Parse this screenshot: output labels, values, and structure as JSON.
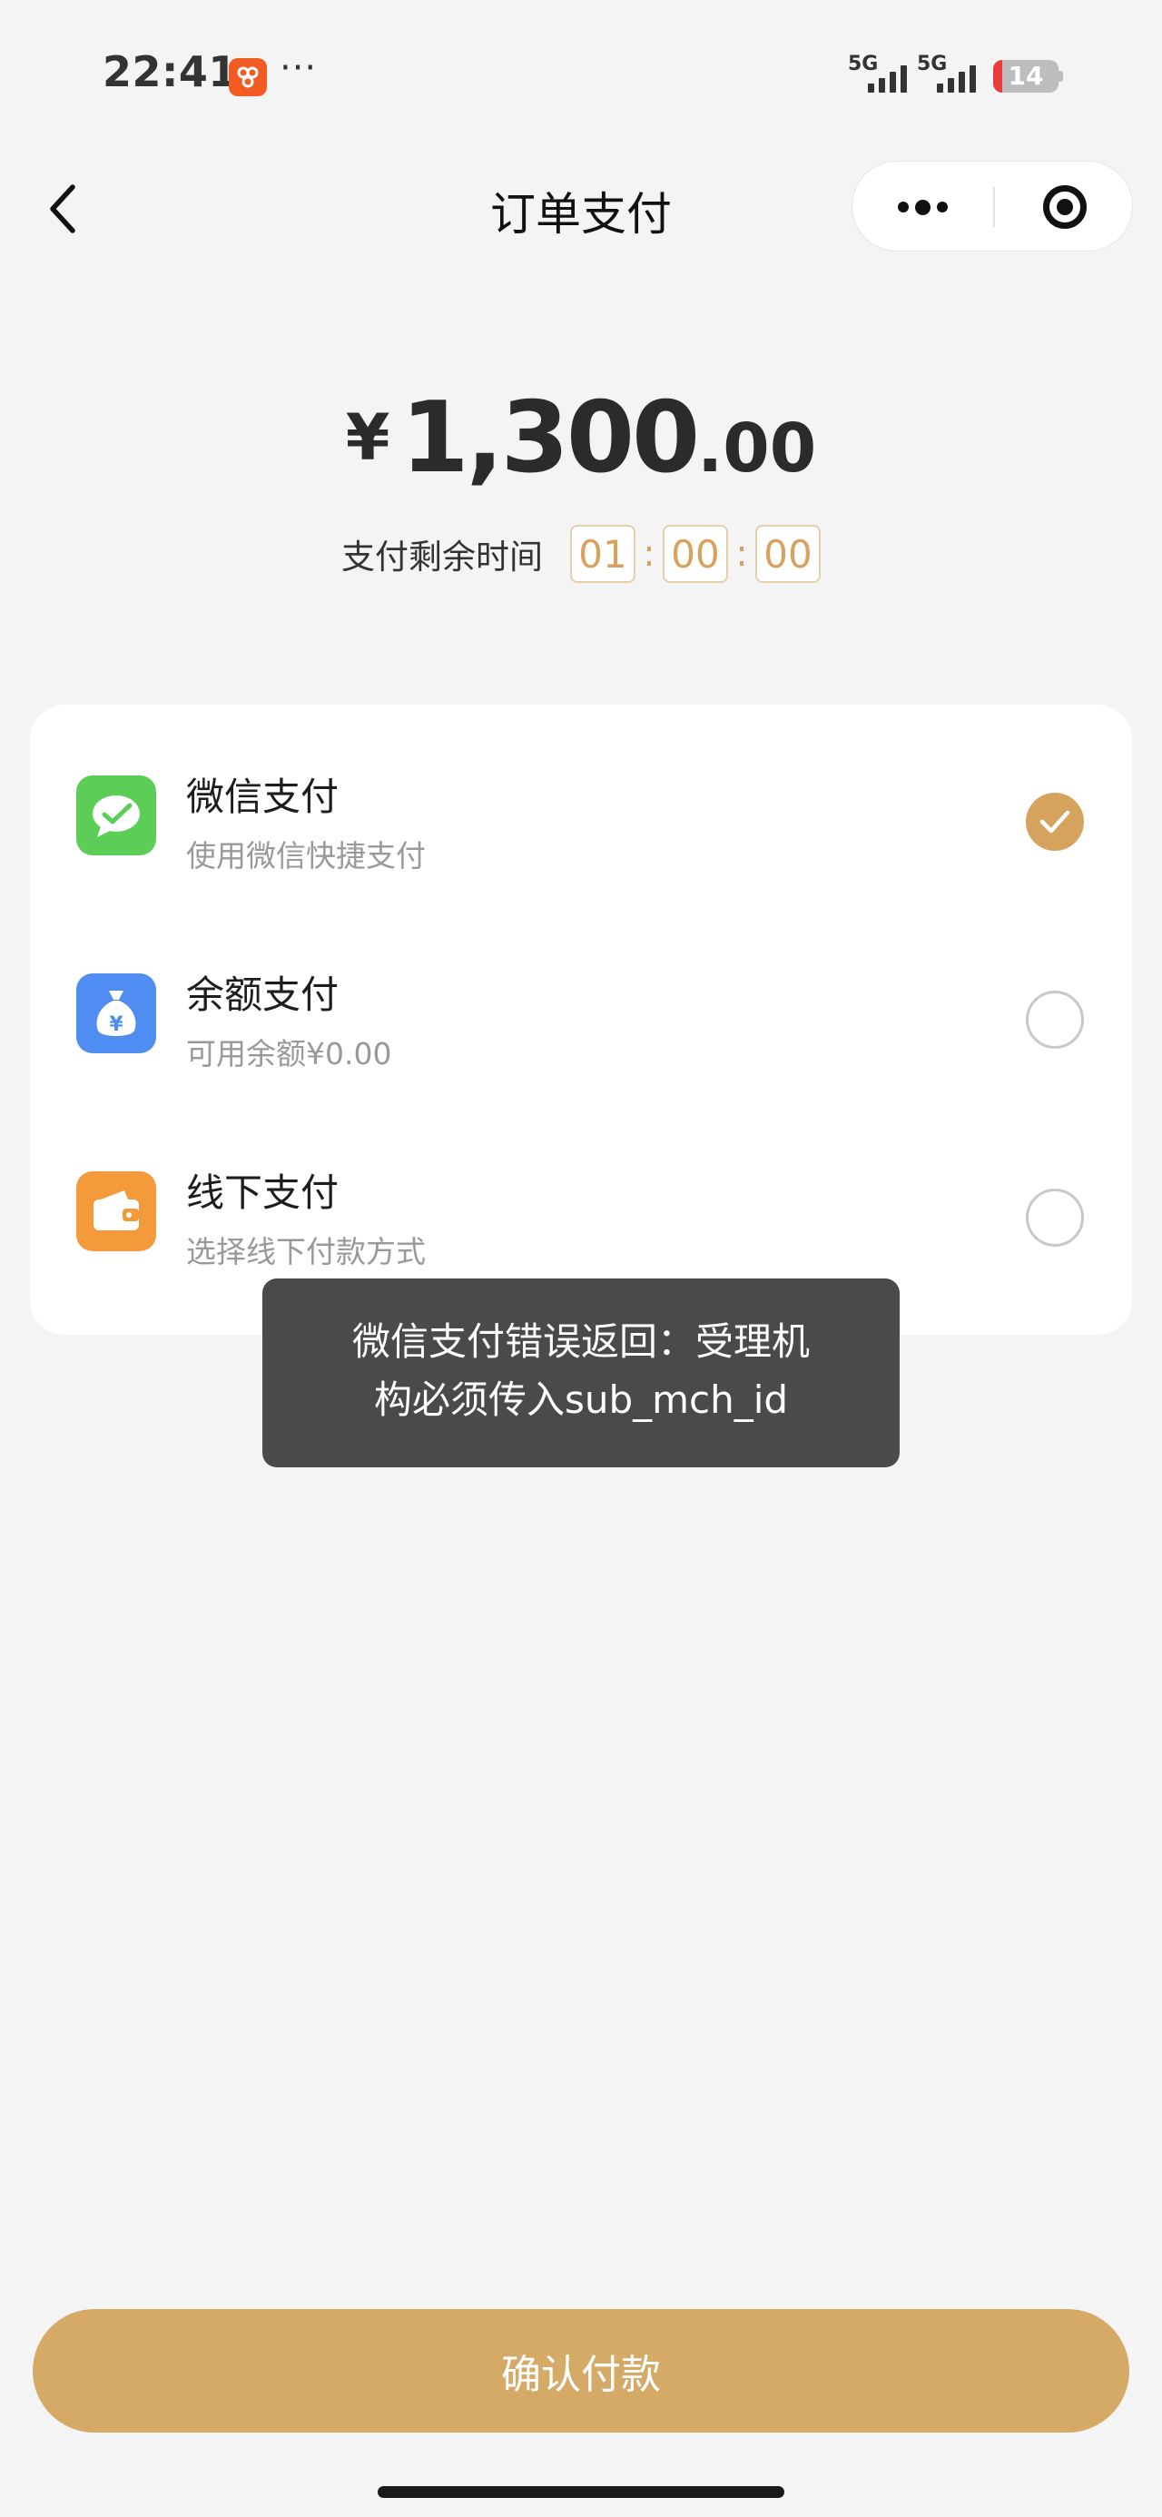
{
  "status_bar": {
    "time": "22:41",
    "more_dots": "···",
    "signal1_label": "5G",
    "signal2_label": "5G",
    "battery_level": "14",
    "battery_color": "#ec3b3b",
    "app_badge_color": "#f25b22"
  },
  "nav": {
    "title": "订单支付",
    "back_icon": "chevron-left-icon",
    "more_icon": "more-dots-icon",
    "close_icon": "target-circle-icon"
  },
  "amount": {
    "currency": "¥",
    "integer": "1,300",
    "decimal": ".00"
  },
  "countdown": {
    "label": "支付剩余时间",
    "hours": "01",
    "minutes": "00",
    "seconds": "00",
    "separator": ":",
    "accent_color": "#d6a25e"
  },
  "payment_methods": [
    {
      "title": "微信支付",
      "subtitle": "使用微信快捷支付",
      "selected": true,
      "icon": "wechat-icon",
      "icon_color": "#5ccd56"
    },
    {
      "title": "余额支付",
      "subtitle": "可用余额¥0.00",
      "selected": false,
      "icon": "money-bag-icon",
      "icon_color": "#4f8df2"
    },
    {
      "title": "线下支付",
      "subtitle": "选择线下付款方式",
      "selected": false,
      "icon": "wallet-icon",
      "icon_color": "#f49a3a"
    }
  ],
  "toast": {
    "line1": "微信支付错误返回：受理机",
    "line2": "构必须传入sub_mch_id"
  },
  "confirm_button": {
    "label": "确认付款",
    "color": "#d5a966"
  }
}
